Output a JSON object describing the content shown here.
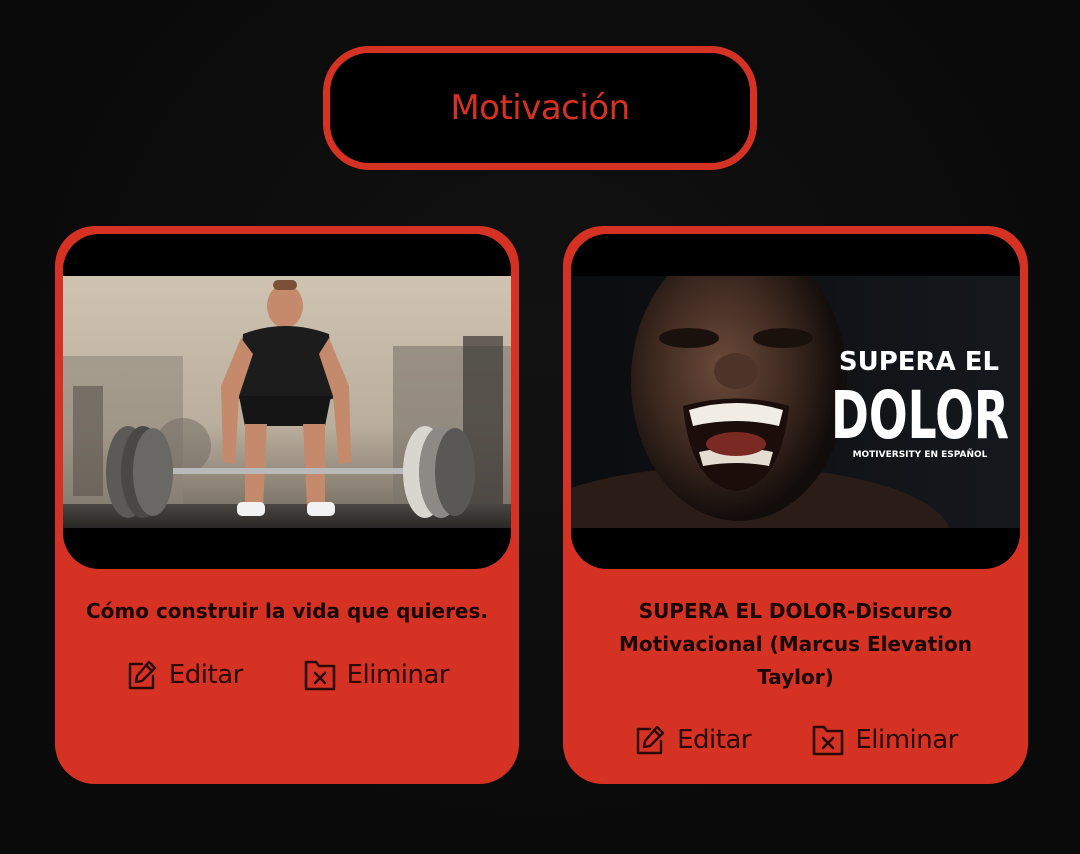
{
  "category": {
    "title": "Motivación"
  },
  "colors": {
    "accent": "#d63224",
    "background": "#0b0b0b",
    "thumb_bg": "#000000"
  },
  "cards": [
    {
      "title": "Cómo construir la vida que quieres.",
      "image": "deadlift-gym-photo",
      "edit_label": "Editar",
      "delete_label": "Eliminar"
    },
    {
      "title": "SUPERA EL DOLOR-Discurso Motivacional (Marcus Elevation Taylor)",
      "image": "screaming-man-thumbnail",
      "thumb_text": {
        "line1": "SUPERA EL",
        "line2": "DOLOR",
        "line3": "MOTIVERSITY EN ESPAÑOL"
      },
      "edit_label": "Editar",
      "delete_label": "Eliminar"
    }
  ]
}
